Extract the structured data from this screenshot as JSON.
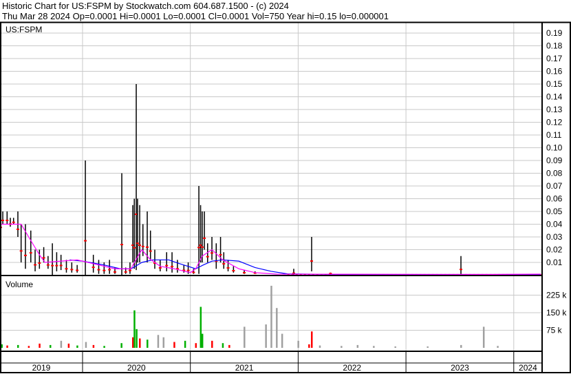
{
  "header": {
    "title": "Historic Chart for US:FSPM by Stockwatch.com 604.687.1500 - (c) 2024",
    "quote": "Thu Mar 28 2024  Op=0.0001  Hi=0.0001  Lo=0.0001  Cl=0.0001  Vol=750  Year hi=0.15  lo=0.000001"
  },
  "colors": {
    "price": "#000000",
    "close": "#ff0000",
    "ma_short": "#ff00ff",
    "ma_long": "#0000ff",
    "vol_up": "#00b000",
    "vol_down": "#ff0000",
    "vol_flat": "#a0a0a0",
    "grid": "#c8c8c8"
  },
  "chart_data": [
    {
      "type": "line",
      "title": "US:FSPM",
      "ylabel": "",
      "xlabel": "",
      "ylim": [
        0,
        0.195
      ],
      "yticks": [
        "0.01",
        "0.02",
        "0.03",
        "0.04",
        "0.05",
        "0.06",
        "0.07",
        "0.08",
        "0.09",
        "0.10",
        "0.11",
        "0.12",
        "0.13",
        "0.14",
        "0.15",
        "0.16",
        "0.17",
        "0.18",
        "0.19"
      ],
      "xticks": [
        "2019",
        "2020",
        "2021",
        "2022",
        "2023",
        "2024"
      ],
      "bars_date_hi_lo": [
        [
          2019.24,
          0.055,
          0.03
        ],
        [
          2019.26,
          0.05,
          0.04
        ],
        [
          2019.3,
          0.05,
          0.04
        ],
        [
          2019.33,
          0.045,
          0.038
        ],
        [
          2019.36,
          0.045,
          0.04
        ],
        [
          2019.4,
          0.05,
          0.03
        ],
        [
          2019.43,
          0.04,
          0.01
        ],
        [
          2019.47,
          0.04,
          0.005
        ],
        [
          2019.52,
          0.035,
          0.01
        ],
        [
          2019.56,
          0.02,
          0.003
        ],
        [
          2019.6,
          0.02,
          0.005
        ],
        [
          2019.64,
          0.022,
          0.01
        ],
        [
          2019.68,
          0.015,
          0.005
        ],
        [
          2019.72,
          0.025,
          0
        ],
        [
          2019.76,
          0.018,
          0.003
        ],
        [
          2019.8,
          0.016,
          0.004
        ],
        [
          2019.85,
          0.012,
          0.002
        ],
        [
          2019.9,
          0.01,
          0.002
        ],
        [
          2019.95,
          0.008,
          0.002
        ],
        [
          2020.026,
          0.09,
          0
        ],
        [
          2020.1,
          0.016,
          0.002
        ],
        [
          2020.15,
          0.012,
          0.001
        ],
        [
          2020.2,
          0.01,
          0.001
        ],
        [
          2020.25,
          0.012,
          0.001
        ],
        [
          2020.3,
          0.006,
          0.001
        ],
        [
          2020.364,
          0.08,
          0
        ],
        [
          2020.4,
          0.006,
          0.001
        ],
        [
          2020.44,
          0.01,
          0.001
        ],
        [
          2020.466,
          0.055,
          0.01
        ],
        [
          2020.48,
          0.06,
          0.005
        ],
        [
          2020.498,
          0.15,
          0.004
        ],
        [
          2020.51,
          0.06,
          0.01
        ],
        [
          2020.53,
          0.055,
          0.01
        ],
        [
          2020.56,
          0.04,
          0.015
        ],
        [
          2020.6,
          0.05,
          0.01
        ],
        [
          2020.63,
          0.035,
          0.012
        ],
        [
          2020.67,
          0.02,
          0.005
        ],
        [
          2020.72,
          0.012,
          0.003
        ],
        [
          2020.78,
          0.018,
          0.003
        ],
        [
          2020.83,
          0.018,
          0.002
        ],
        [
          2020.88,
          0.012,
          0.002
        ],
        [
          2020.94,
          0.008,
          0.002
        ],
        [
          2020.98,
          0.01,
          0.001
        ],
        [
          2021.03,
          0.005,
          0.001
        ],
        [
          2021.079,
          0.07,
          0.001
        ],
        [
          2021.095,
          0.055,
          0.01
        ],
        [
          2021.11,
          0.05,
          0.01
        ],
        [
          2021.13,
          0.05,
          0.02
        ],
        [
          2021.16,
          0.025,
          0.01
        ],
        [
          2021.2,
          0.03,
          0.012
        ],
        [
          2021.24,
          0.025,
          0.005
        ],
        [
          2021.28,
          0.03,
          0.01
        ],
        [
          2021.31,
          0.018,
          0.005
        ],
        [
          2021.35,
          0.012,
          0.003
        ],
        [
          2021.4,
          0.007,
          0.002
        ],
        [
          2021.5,
          0.004,
          0.001
        ],
        [
          2021.6,
          0.003,
          0.001
        ],
        [
          2021.959,
          0.005,
          0
        ],
        [
          2022.125,
          0.03,
          0.003
        ],
        [
          2022.3,
          0.002,
          0.001
        ],
        [
          2023.51,
          0.015,
          0
        ]
      ],
      "series": [
        {
          "name": "ma_long",
          "points": [
            [
              2019.88,
              0.012
            ],
            [
              2020.0,
              0.011
            ],
            [
              2020.2,
              0.008
            ],
            [
              2020.35,
              0.005
            ],
            [
              2020.45,
              0.005
            ],
            [
              2020.55,
              0.01
            ],
            [
              2020.65,
              0.012
            ],
            [
              2020.8,
              0.012
            ],
            [
              2020.9,
              0.009
            ],
            [
              2021.05,
              0.005
            ],
            [
              2021.12,
              0.008
            ],
            [
              2021.2,
              0.011
            ],
            [
              2021.3,
              0.012
            ],
            [
              2021.45,
              0.011
            ],
            [
              2021.6,
              0.006
            ],
            [
              2021.75,
              0.003
            ],
            [
              2021.9,
              0.001
            ],
            [
              2022.1,
              0.0008
            ],
            [
              2022.5,
              0.0005
            ],
            [
              2024.25,
              0.0005
            ]
          ]
        },
        {
          "name": "ma_short",
          "points": [
            [
              2019.24,
              0.04
            ],
            [
              2019.43,
              0.04
            ],
            [
              2019.5,
              0.03
            ],
            [
              2019.6,
              0.016
            ],
            [
              2019.65,
              0.01
            ],
            [
              2019.8,
              0.011
            ],
            [
              2019.95,
              0.012
            ],
            [
              2020.1,
              0.009
            ],
            [
              2020.3,
              0.005
            ],
            [
              2020.45,
              0.005
            ],
            [
              2020.48,
              0.01
            ],
            [
              2020.55,
              0.02
            ],
            [
              2020.62,
              0.013
            ],
            [
              2020.72,
              0.007
            ],
            [
              2020.85,
              0.005
            ],
            [
              2021.0,
              0.002
            ],
            [
              2021.05,
              0.005
            ],
            [
              2021.11,
              0.015
            ],
            [
              2021.2,
              0.02
            ],
            [
              2021.3,
              0.012
            ],
            [
              2021.45,
              0.005
            ],
            [
              2021.6,
              0.002
            ],
            [
              2021.8,
              0.0008
            ],
            [
              2023.8,
              0.0006
            ],
            [
              2024.25,
              0.0008
            ]
          ]
        }
      ]
    },
    {
      "type": "bar",
      "title": "Volume",
      "ylim": [
        0,
        290
      ],
      "yticks": [
        "75 k",
        "150 k",
        "225 k"
      ],
      "ytick_values": [
        75,
        150,
        225
      ],
      "bars_date_k_dir": [
        [
          2019.25,
          15,
          "up"
        ],
        [
          2019.3,
          10,
          "down"
        ],
        [
          2019.4,
          12,
          "up"
        ],
        [
          2019.5,
          8,
          "down"
        ],
        [
          2019.6,
          18,
          "down"
        ],
        [
          2019.7,
          12,
          "up"
        ],
        [
          2019.8,
          30,
          "flat"
        ],
        [
          2019.87,
          18,
          "down"
        ],
        [
          2019.95,
          10,
          "up"
        ],
        [
          2020.03,
          25,
          "flat"
        ],
        [
          2020.1,
          12,
          "down"
        ],
        [
          2020.2,
          8,
          "up"
        ],
        [
          2020.36,
          20,
          "up"
        ],
        [
          2020.466,
          45,
          "down"
        ],
        [
          2020.48,
          160,
          "up"
        ],
        [
          2020.5,
          80,
          "up"
        ],
        [
          2020.53,
          40,
          "down"
        ],
        [
          2020.6,
          35,
          "up"
        ],
        [
          2020.7,
          55,
          "flat"
        ],
        [
          2020.75,
          45,
          "flat"
        ],
        [
          2020.85,
          25,
          "down"
        ],
        [
          2020.95,
          30,
          "up"
        ],
        [
          2021.05,
          20,
          "down"
        ],
        [
          2021.095,
          175,
          "up"
        ],
        [
          2021.11,
          60,
          "up"
        ],
        [
          2021.2,
          30,
          "down"
        ],
        [
          2021.3,
          20,
          "up"
        ],
        [
          2021.36,
          12,
          "down"
        ],
        [
          2021.5,
          90,
          "flat"
        ],
        [
          2021.7,
          100,
          "flat"
        ],
        [
          2021.75,
          265,
          "flat"
        ],
        [
          2021.8,
          170,
          "flat"
        ],
        [
          2021.85,
          60,
          "flat"
        ],
        [
          2022.0,
          30,
          "flat"
        ],
        [
          2022.1,
          15,
          "down"
        ],
        [
          2022.125,
          70,
          "down"
        ],
        [
          2022.2,
          10,
          "flat"
        ],
        [
          2022.4,
          8,
          "flat"
        ],
        [
          2022.55,
          12,
          "flat"
        ],
        [
          2022.7,
          8,
          "flat"
        ],
        [
          2022.9,
          6,
          "flat"
        ],
        [
          2023.2,
          6,
          "flat"
        ],
        [
          2023.51,
          12,
          "flat"
        ],
        [
          2023.72,
          90,
          "flat"
        ],
        [
          2023.85,
          8,
          "flat"
        ]
      ]
    }
  ]
}
